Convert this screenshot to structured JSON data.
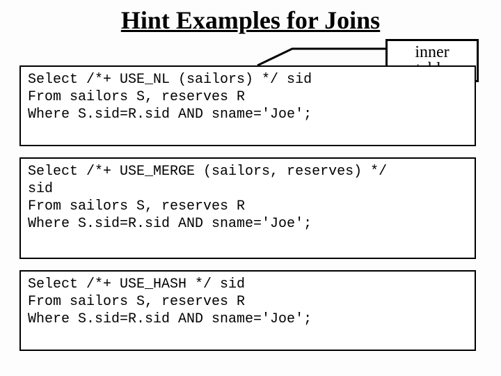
{
  "title": "Hint Examples for Joins",
  "callout": {
    "line1": "inner",
    "line2": "table"
  },
  "boxes": {
    "b1": {
      "l1": "Select /*+ USE_NL (sailors) */ sid",
      "l2": "From sailors S, reserves R",
      "l3": "Where S.sid=R.sid AND sname='Joe';"
    },
    "b2": {
      "l1": "Select /*+ USE_MERGE (sailors, reserves) */",
      "l2": "sid",
      "l3": "From sailors S, reserves R",
      "l4": "Where S.sid=R.sid AND sname='Joe';"
    },
    "b3": {
      "l1": "Select /*+ USE_HASH */ sid",
      "l2": "From sailors S, reserves R",
      "l3": "Where S.sid=R.sid AND sname='Joe';"
    }
  }
}
